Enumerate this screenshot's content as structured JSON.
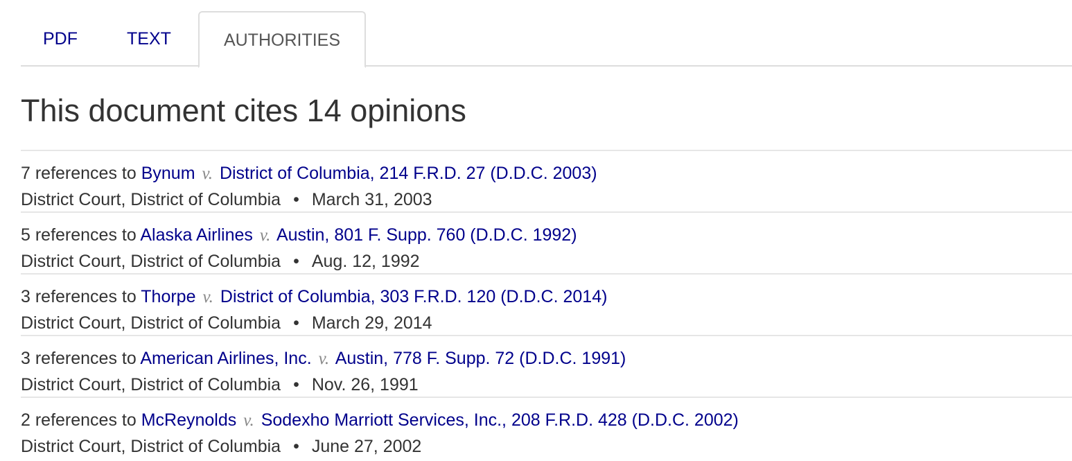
{
  "tabs": [
    {
      "label": "PDF",
      "active": false
    },
    {
      "label": "TEXT",
      "active": false
    },
    {
      "label": "AUTHORITIES",
      "active": true
    }
  ],
  "heading": "This document cites 14 opinions",
  "separator_versus": "v.",
  "separator_bullet": "•",
  "citations": [
    {
      "count_text": "7 references to",
      "party1": "Bynum",
      "party2_cite": "District of Columbia, 214 F.R.D. 27 (D.D.C. 2003)",
      "court": "District Court, District of Columbia",
      "date": "March 31, 2003"
    },
    {
      "count_text": "5 references to",
      "party1": "Alaska Airlines",
      "party2_cite": "Austin, 801 F. Supp. 760 (D.D.C. 1992)",
      "court": "District Court, District of Columbia",
      "date": "Aug. 12, 1992"
    },
    {
      "count_text": "3 references to",
      "party1": "Thorpe",
      "party2_cite": "District of Columbia, 303 F.R.D. 120 (D.D.C. 2014)",
      "court": "District Court, District of Columbia",
      "date": "March 29, 2014"
    },
    {
      "count_text": "3 references to",
      "party1": "American Airlines, Inc.",
      "party2_cite": "Austin, 778 F. Supp. 72 (D.D.C. 1991)",
      "court": "District Court, District of Columbia",
      "date": "Nov. 26, 1991"
    },
    {
      "count_text": "2 references to",
      "party1": "McReynolds",
      "party2_cite": "Sodexho Marriott Services, Inc., 208 F.R.D. 428 (D.D.C. 2002)",
      "court": "District Court, District of Columbia",
      "date": "June 27, 2002"
    }
  ]
}
